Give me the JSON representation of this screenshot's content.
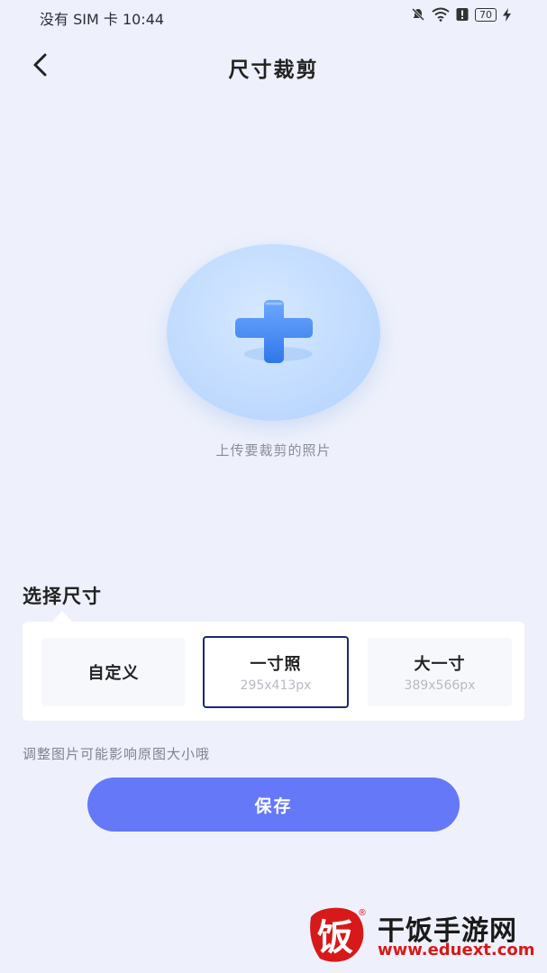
{
  "status_bar": {
    "carrier_time": "没有 SIM 卡 10:44",
    "battery": "70",
    "icons": [
      "mute-icon",
      "wifi-icon",
      "alert-icon",
      "battery-icon",
      "charging-icon"
    ]
  },
  "header": {
    "title": "尺寸裁剪",
    "back_icon": "chevron-left-icon"
  },
  "upload": {
    "icon": "plus-icon",
    "label": "上传要裁剪的照片"
  },
  "size_section": {
    "title": "选择尺寸",
    "options": [
      {
        "name": "自定义",
        "size": "",
        "selected": false
      },
      {
        "name": "一寸照",
        "size": "295x413px",
        "selected": true
      },
      {
        "name": "大一寸",
        "size": "389x566px",
        "selected": false
      }
    ]
  },
  "hint": "调整图片可能影响原图大小哦",
  "save_label": "保存",
  "watermark": {
    "logo_char": "饭",
    "name": "干饭手游网",
    "url": "www.eduext.com",
    "registered": "®"
  },
  "colors": {
    "background": "#eef1fb",
    "accent": "#6478f8",
    "selected_border": "#1a2a6c",
    "watermark_red": "#d71919"
  }
}
